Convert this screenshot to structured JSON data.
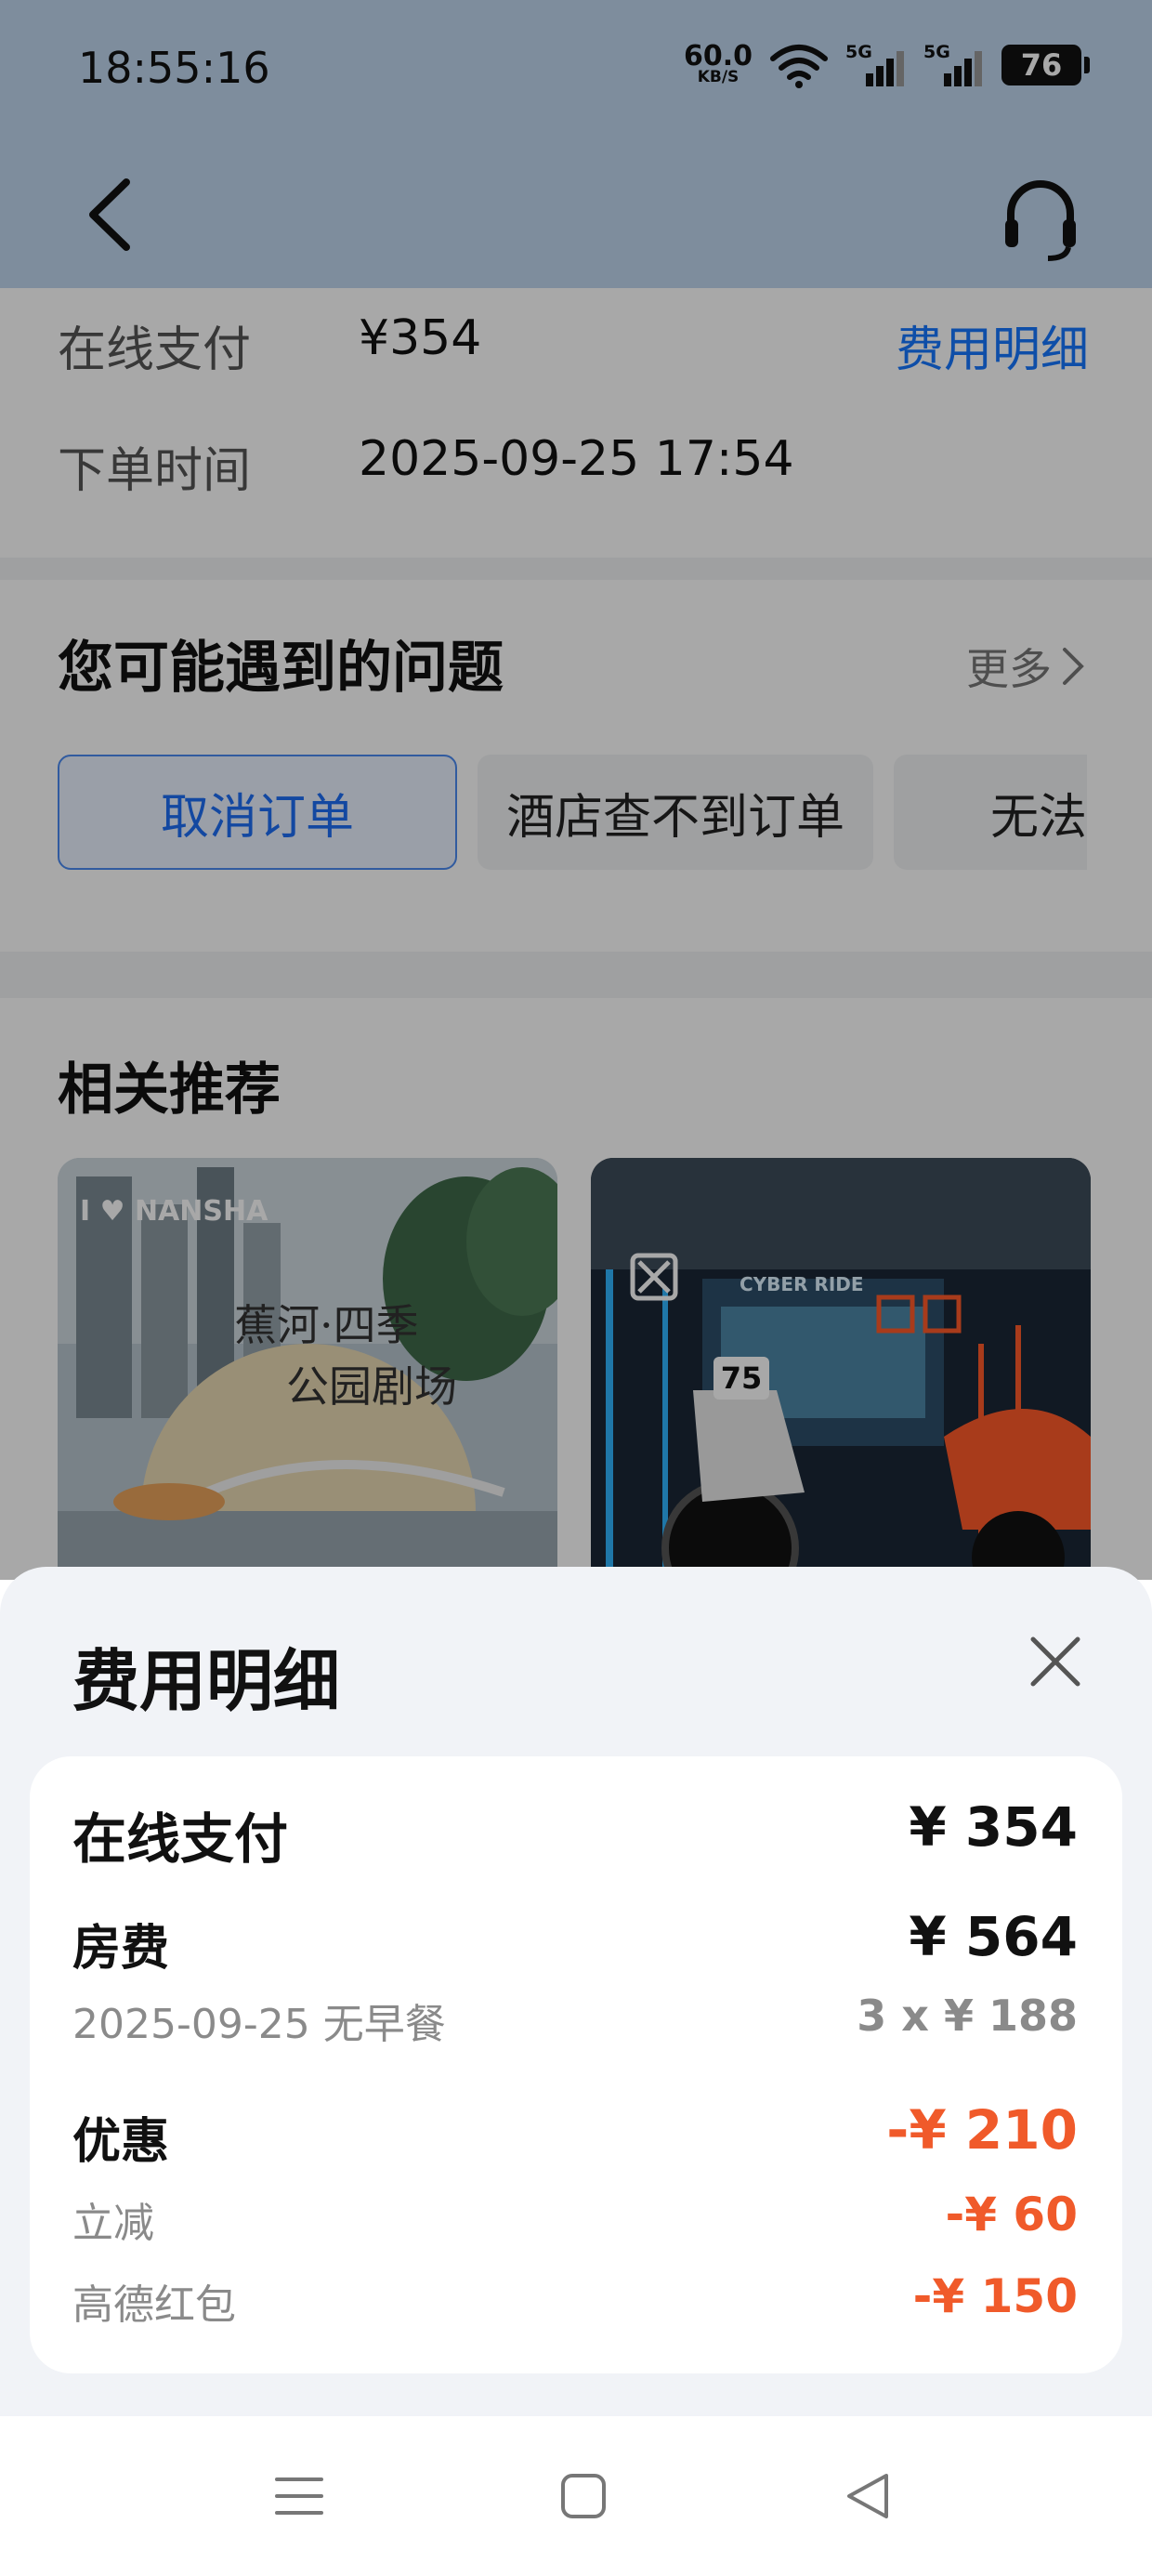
{
  "status_bar": {
    "time": "18:55:16",
    "net_speed": "60.0",
    "net_unit": "KB/S",
    "sim1": "5G",
    "sim2": "5G",
    "battery": "76",
    "icons": [
      "wifi-icon",
      "signal-icon",
      "battery-icon"
    ]
  },
  "navbar": {
    "back_icon": "chevron-left-icon",
    "support_icon": "headset-icon"
  },
  "order": {
    "pay_label": "在线支付",
    "pay_value": "¥354",
    "detail_link": "费用明细",
    "time_label": "下单时间",
    "time_value": "2025-09-25 17:54"
  },
  "problems": {
    "title": "您可能遇到的问题",
    "more": "更多",
    "chips": [
      "取消订单",
      "酒店查不到订单",
      "无法"
    ]
  },
  "recommend": {
    "title": "相关推荐",
    "card1_sign_line1": "蕉河·四季",
    "card1_sign_line2": "公园剧场",
    "card1_sign_top": "I ♥ NANSHA",
    "card2_plate": "75",
    "card2_screen_text": "CYBER RIDE"
  },
  "sheet": {
    "title": "费用明细",
    "close_icon": "close-icon",
    "online_pay_label": "在线支付",
    "online_pay_value": "¥ 354",
    "room_label": "房费",
    "room_value": "¥ 564",
    "room_sub": "2025-09-25 无早餐",
    "room_sub_value": "3 x ¥ 188",
    "discount_label": "优惠",
    "discount_value": "-¥ 210",
    "discount_items": [
      {
        "label": "立减",
        "value": "-¥ 60"
      },
      {
        "label": "高德红包",
        "value": "-¥ 150"
      }
    ]
  },
  "system_nav": {
    "icons": [
      "menu-icon",
      "home-square-icon",
      "back-triangle-icon"
    ]
  },
  "colors": {
    "accent_blue": "#1677ff",
    "discount_red": "#f05a2a",
    "header_bg": "#bfd6ee"
  }
}
